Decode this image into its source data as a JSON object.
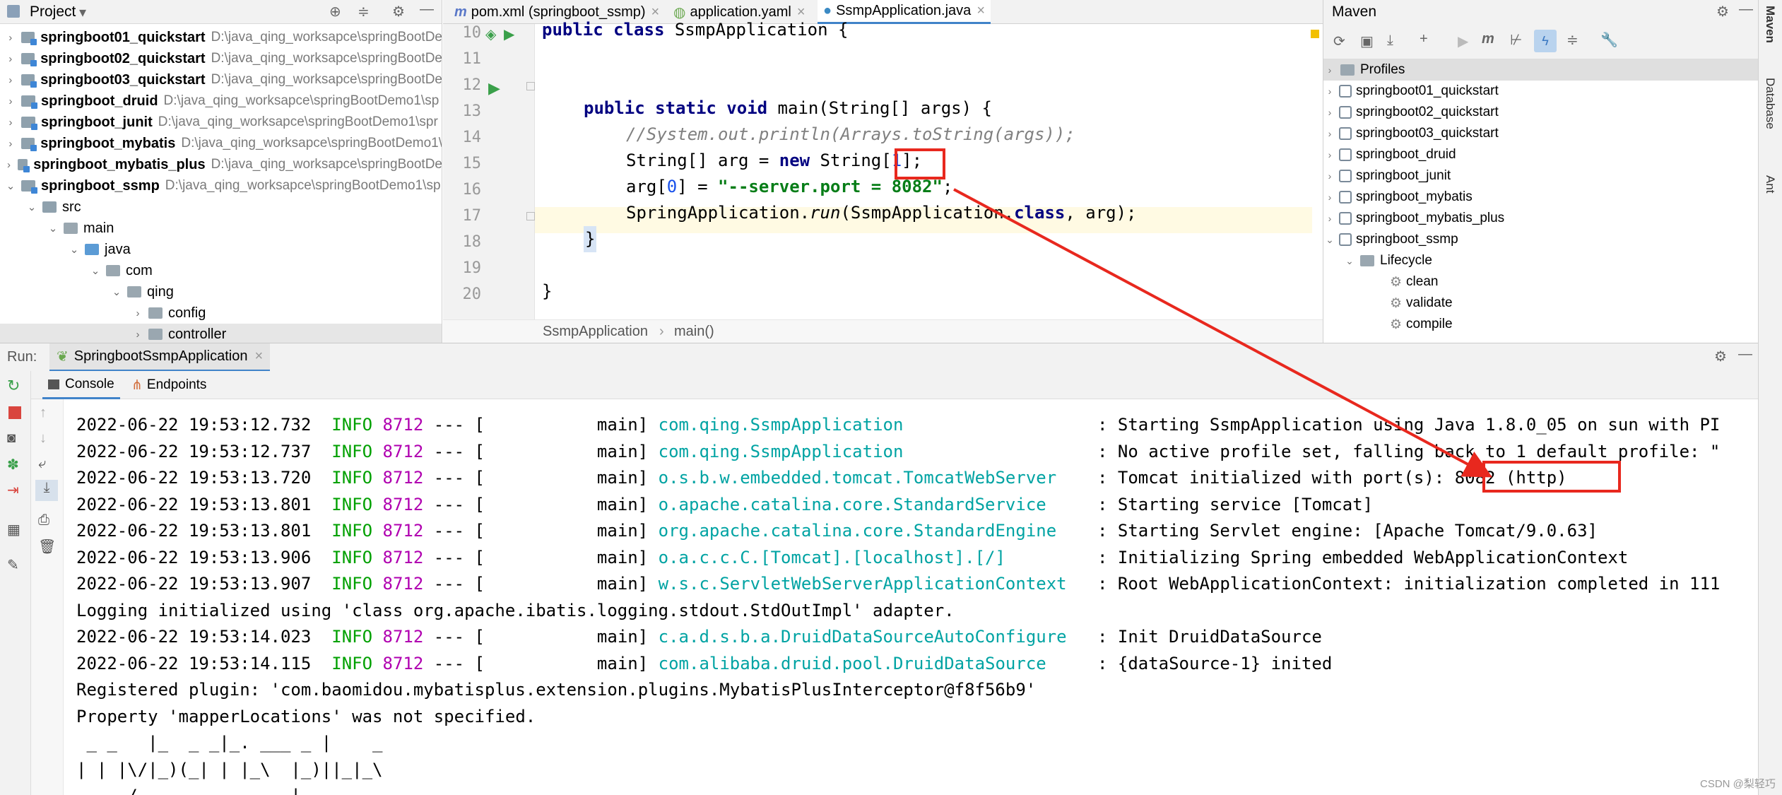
{
  "project": {
    "title": "Project",
    "items": [
      {
        "name": "springboot01_quickstart",
        "path": "D:\\java_qing_worksapce\\springBootDe"
      },
      {
        "name": "springboot02_quickstart",
        "path": "D:\\java_qing_worksapce\\springBootDe"
      },
      {
        "name": "springboot03_quickstart",
        "path": "D:\\java_qing_worksapce\\springBootDe"
      },
      {
        "name": "springboot_druid",
        "path": "D:\\java_qing_worksapce\\springBootDemo1\\sp"
      },
      {
        "name": "springboot_junit",
        "path": "D:\\java_qing_worksapce\\springBootDemo1\\spr"
      },
      {
        "name": "springboot_mybatis",
        "path": "D:\\java_qing_worksapce\\springBootDemo1\\"
      },
      {
        "name": "springboot_mybatis_plus",
        "path": "D:\\java_qing_worksapce\\springBootDe"
      },
      {
        "name": "springboot_ssmp",
        "path": "D:\\java_qing_worksapce\\springBootDemo1\\sp"
      }
    ],
    "folders": [
      "src",
      "main",
      "java",
      "com",
      "qing",
      "config",
      "controller"
    ]
  },
  "editor": {
    "tabs": [
      {
        "label": "pom.xml (springboot_ssmp)"
      },
      {
        "label": "application.yaml"
      },
      {
        "label": "SsmpApplication.java"
      }
    ],
    "line_numbers": [
      "10",
      "11",
      "12",
      "13",
      "14",
      "15",
      "16",
      "17",
      "18",
      "19",
      "20"
    ],
    "code": {
      "l10a": "public class",
      "l10b": " SsmpApplication {",
      "l12a": "public static void",
      "l12b": " main(String[] args) {",
      "l13": "//System.out.println(Arrays.toString(args));",
      "l14a": "String[] arg = ",
      "l14b": "new",
      "l14c": " String[",
      "l14d": "1",
      "l14e": "];",
      "l15a": "arg[",
      "l15b": "0",
      "l15c": "] = ",
      "l15d": "\"--server.port = ",
      "l15e": "8082",
      "l15f": "\"",
      "l15g": ";",
      "l16a": "SpringApplication.",
      "l16b": "run",
      "l16c": "(SsmpApplication.",
      "l16d": "class",
      "l16e": ", arg);",
      "l17": "}",
      "l19": "}"
    },
    "breadcrumb": [
      "SsmpApplication",
      "main()"
    ]
  },
  "maven": {
    "title": "Maven",
    "items": [
      "Profiles",
      "springboot01_quickstart",
      "springboot02_quickstart",
      "springboot03_quickstart",
      "springboot_druid",
      "springboot_junit",
      "springboot_mybatis",
      "springboot_mybatis_plus",
      "springboot_ssmp"
    ],
    "lifecycle": "Lifecycle",
    "phases": [
      "clean",
      "validate",
      "compile"
    ]
  },
  "right_strip": [
    "Maven",
    "Database",
    "Ant"
  ],
  "run": {
    "label": "Run:",
    "config": "SpringbootSsmpApplication",
    "console_tab": "Console",
    "endpoints_tab": "Endpoints"
  },
  "console": [
    {
      "ts": "2022-06-22 19:53:12.732",
      "lv": "INFO",
      "pid": "8712",
      "sep": " --- [           main] ",
      "cls": "com.qing.SsmpApplication                  ",
      "msg": " : Starting SsmpApplication using Java 1.8.0_05 on sun with PI"
    },
    {
      "ts": "2022-06-22 19:53:12.737",
      "lv": "INFO",
      "pid": "8712",
      "sep": " --- [           main] ",
      "cls": "com.qing.SsmpApplication                  ",
      "msg": " : No active profile set, falling back to 1 default profile: \""
    },
    {
      "ts": "2022-06-22 19:53:13.720",
      "lv": "INFO",
      "pid": "8712",
      "sep": " --- [           main] ",
      "cls": "o.s.b.w.embedded.tomcat.TomcatWebServer   ",
      "msg": " : Tomcat initialized with port(s): 8082 (http)"
    },
    {
      "ts": "2022-06-22 19:53:13.801",
      "lv": "INFO",
      "pid": "8712",
      "sep": " --- [           main] ",
      "cls": "o.apache.catalina.core.StandardService    ",
      "msg": " : Starting service [Tomcat]"
    },
    {
      "ts": "2022-06-22 19:53:13.801",
      "lv": "INFO",
      "pid": "8712",
      "sep": " --- [           main] ",
      "cls": "org.apache.catalina.core.StandardEngine   ",
      "msg": " : Starting Servlet engine: [Apache Tomcat/9.0.63]"
    },
    {
      "ts": "2022-06-22 19:53:13.906",
      "lv": "INFO",
      "pid": "8712",
      "sep": " --- [           main] ",
      "cls": "o.a.c.c.C.[Tomcat].[localhost].[/]        ",
      "msg": " : Initializing Spring embedded WebApplicationContext"
    },
    {
      "ts": "2022-06-22 19:53:13.907",
      "lv": "INFO",
      "pid": "8712",
      "sep": " --- [           main] ",
      "cls": "w.s.c.ServletWebServerApplicationContext  ",
      "msg": " : Root WebApplicationContext: initialization completed in 111"
    },
    {
      "plain": "Logging initialized using 'class org.apache.ibatis.logging.stdout.StdOutImpl' adapter."
    },
    {
      "ts": "2022-06-22 19:53:14.023",
      "lv": "INFO",
      "pid": "8712",
      "sep": " --- [           main] ",
      "cls": "c.a.d.s.b.a.DruidDataSourceAutoConfigure  ",
      "msg": " : Init DruidDataSource"
    },
    {
      "ts": "2022-06-22 19:53:14.115",
      "lv": "INFO",
      "pid": "8712",
      "sep": " --- [           main] ",
      "cls": "com.alibaba.druid.pool.DruidDataSource    ",
      "msg": " : {dataSource-1} inited"
    },
    {
      "plain": "Registered plugin: 'com.baomidou.mybatisplus.extension.plugins.MybatisPlusInterceptor@f8f56b9'"
    },
    {
      "plain": "Property 'mapperLocations' was not specified."
    },
    {
      "plain": " _ _   |_  _ _|_. ___ _ |    _ "
    },
    {
      "plain": "| | |\\/|_)(_| | |_\\  |_)||_|_\\ "
    },
    {
      "plain": "     /               |         "
    }
  ],
  "watermark": "CSDN @梨轻巧"
}
